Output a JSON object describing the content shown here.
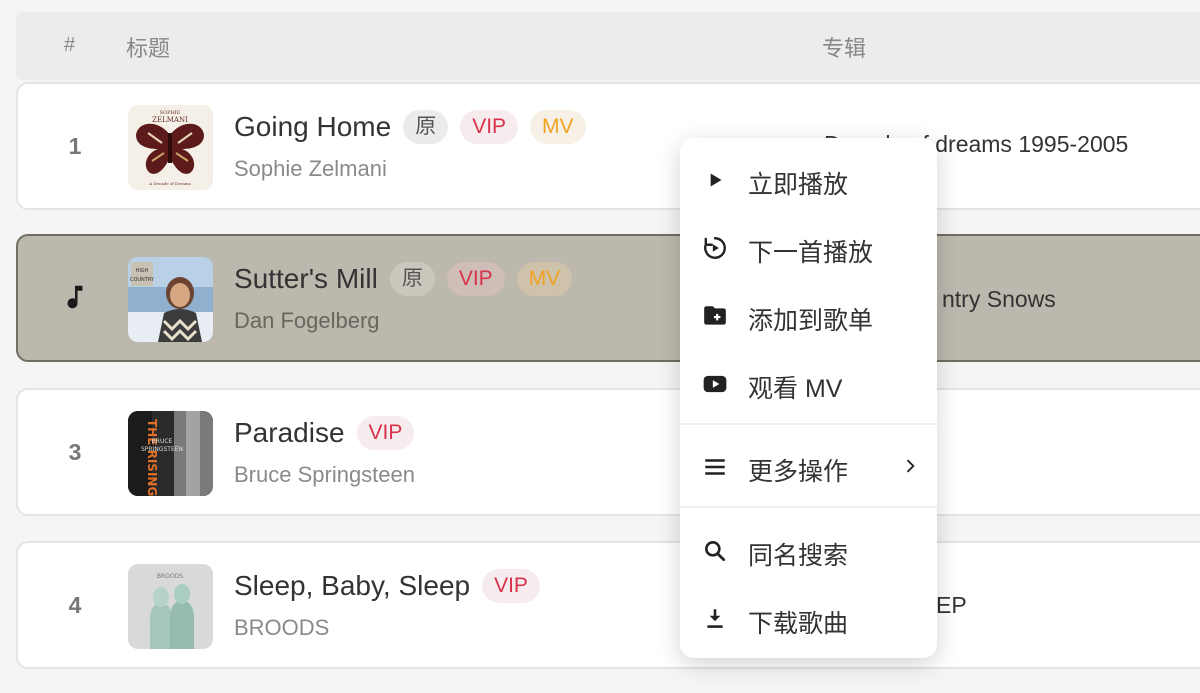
{
  "header": {
    "hash": "#",
    "title": "标题",
    "album": "专辑"
  },
  "tracks": [
    {
      "index": "1",
      "title": "Going Home",
      "badges": [
        "原",
        "VIP",
        "MV"
      ],
      "artist": "Sophie Zelmani",
      "album": "Decade of dreams 1995-2005",
      "playing": false
    },
    {
      "index": "2",
      "title": "Sutter's Mill",
      "badges": [
        "原",
        "VIP",
        "MV"
      ],
      "artist": "Dan Fogelberg",
      "album": "High Country Snows",
      "playing": true
    },
    {
      "index": "3",
      "title": "Paradise",
      "badges": [
        "VIP"
      ],
      "artist": "Bruce Springsteen",
      "album": "The Rising",
      "playing": false
    },
    {
      "index": "4",
      "title": "Sleep, Baby, Sleep",
      "badges": [
        "VIP"
      ],
      "artist": "BROODS",
      "album": "BROODS EP",
      "playing": false
    }
  ],
  "visible_album_fragments": {
    "row1": "Decade of dreams 1995-2005",
    "row2": "ntry Snows",
    "row4": "EP"
  },
  "context_menu": {
    "items": [
      {
        "label": "立即播放",
        "icon": "play-icon"
      },
      {
        "label": "下一首播放",
        "icon": "play-next-icon"
      },
      {
        "label": "添加到歌单",
        "icon": "folder-add-icon"
      },
      {
        "label": "观看 MV",
        "icon": "youtube-icon"
      },
      {
        "label": "更多操作",
        "icon": "menu-icon"
      },
      {
        "label": "同名搜索",
        "icon": "search-icon"
      },
      {
        "label": "下载歌曲",
        "icon": "download-icon"
      }
    ]
  },
  "colors": {
    "vip": "#d8324a",
    "mv": "#f0a220",
    "playing_row_bg": "#bdb8ad"
  }
}
